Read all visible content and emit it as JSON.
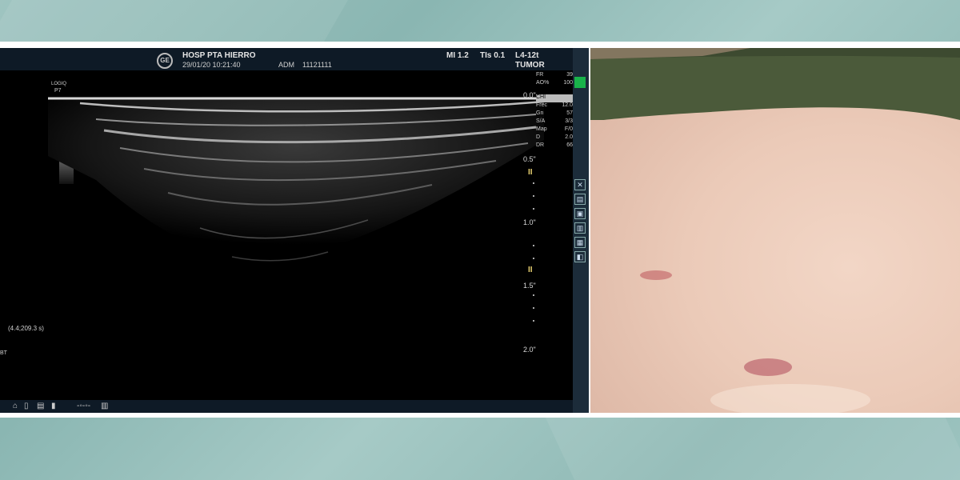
{
  "header": {
    "hospital": "HOSP PTA HIERRO",
    "datetime": "29/01/20 10:21:40",
    "operator": "ADM",
    "patient_id": "11121111",
    "mi": "MI 1.2",
    "tis": "TIs 0.1",
    "probe": "L4-12t",
    "preset": "TUMOR",
    "logo_text": "GE"
  },
  "left_labels": {
    "logiq": "LOGIQ",
    "p": "P7",
    "coords": "(4.4;209.3 s)",
    "bt": "BT"
  },
  "params": [
    {
      "k": "FR",
      "v": "39"
    },
    {
      "k": "AO%",
      "v": "100"
    },
    {
      "k": "CHI",
      "v": ""
    },
    {
      "k": "Frec",
      "v": "12.0"
    },
    {
      "k": "Gn",
      "v": "57"
    },
    {
      "k": "S/A",
      "v": "3/3"
    },
    {
      "k": "Map",
      "v": "F/0"
    },
    {
      "k": "D",
      "v": "2.0"
    },
    {
      "k": "DR",
      "v": "66"
    }
  ],
  "depth_scale": {
    "top": "0.0\"",
    "m1": "0.5\"",
    "m2": "1.0\"",
    "m3": "1.5\"",
    "m4": "2.0\""
  },
  "colors": {
    "status_green": "#19b34a",
    "topbar": "#0e1a26"
  },
  "icons": [
    "tools-icon",
    "print-icon",
    "zoom-icon",
    "measure-icon",
    "camera-icon",
    "save-icon"
  ]
}
